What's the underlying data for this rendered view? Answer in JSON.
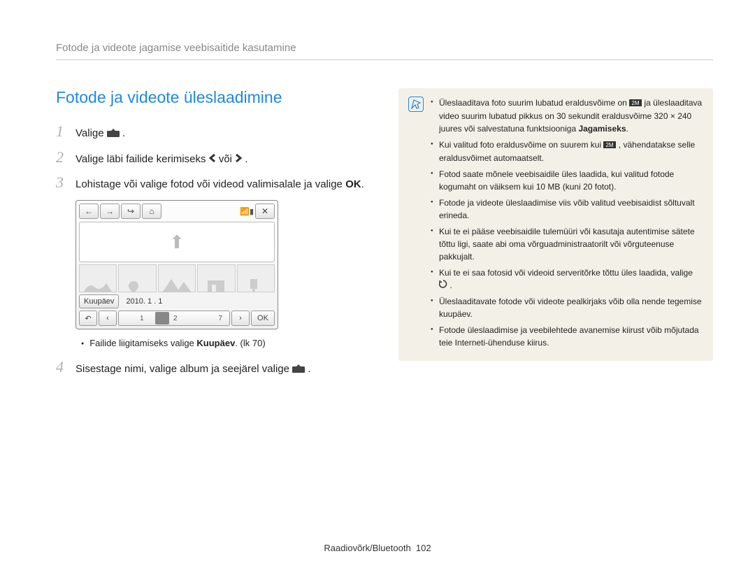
{
  "header": "Fotode ja videote jagamise veebisaitide kasutamine",
  "section_title": "Fotode ja videote üleslaadimine",
  "steps": {
    "s1": {
      "num": "1",
      "pre": "Valige ",
      "post": "."
    },
    "s2": {
      "num": "2",
      "pre": "Valige läbi failide kerimiseks ",
      "mid": " või ",
      "post": "."
    },
    "s3": {
      "num": "3",
      "text_a": "Lohistage või valige fotod või videod valimisalale ja valige ",
      "text_b": "OK",
      "text_c": "."
    },
    "s4": {
      "num": "4",
      "pre": "Sisestage nimi, valige album ja seejärel valige ",
      "post": "."
    }
  },
  "device": {
    "date_label": "Kuupäev",
    "date_value": "2010. 1 . 1",
    "scrub_ticks": {
      "a": "1",
      "b": "2",
      "c": "7"
    },
    "ok": "OK"
  },
  "note": {
    "pre": "Failide liigitamiseks valige ",
    "strong": "Kuupäev",
    "post": ". (lk 70)"
  },
  "info": {
    "i1a": "Üleslaaditava foto suurim lubatud eraldusvõime on ",
    "i1b": " ja üleslaaditava video suurim lubatud pikkus on 30 sekundit eraldusvõime 320 × 240 juures või salvestatuna funktsiooniga ",
    "i1strong": "Jagamiseks",
    "i1c": ".",
    "i2a": "Kui valitud foto eraldusvõime on suurem kui ",
    "i2b": ", vähendatakse selle eraldusvõimet automaatselt.",
    "i3": "Fotod saate mõnele veebisaidile üles laadida, kui valitud fotode kogumaht on väiksem kui 10 MB (kuni 20 fotot).",
    "i4": "Fotode ja videote üleslaadimise viis võib valitud veebisaidist sõltuvalt erineda.",
    "i5": "Kui te ei pääse veebisaidile tulemüüri või kasutaja autentimise sätete tõttu ligi, saate abi oma võrguadministraatorilt või võrguteenuse pakkujalt.",
    "i6a": "Kui te ei saa fotosid või videoid serveritõrke tõttu üles laadida, valige ",
    "i6b": ".",
    "i7": "Üleslaaditavate fotode või videote pealkirjaks võib olla nende tegemise kuupäev.",
    "i8": "Fotode üleslaadimise ja veebilehtede avanemise kiirust võib mõjutada teie Interneti-ühenduse kiirus."
  },
  "footer": {
    "label": "Raadiovõrk/Bluetooth",
    "page": "102"
  }
}
